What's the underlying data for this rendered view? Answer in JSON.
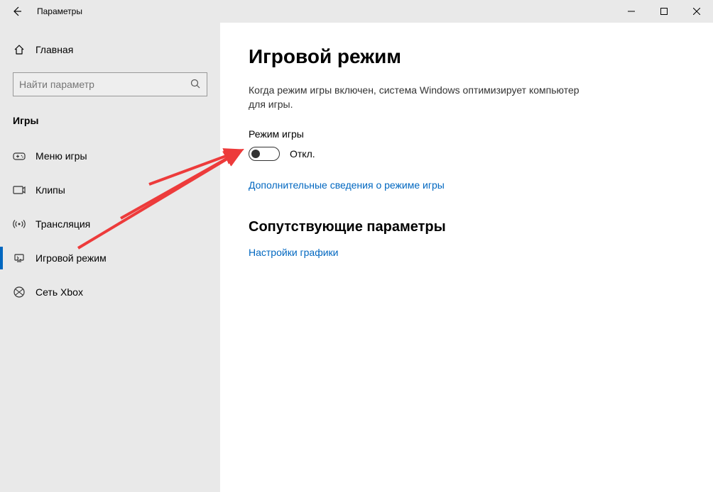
{
  "titlebar": {
    "title": "Параметры"
  },
  "sidebar": {
    "home": "Главная",
    "search_placeholder": "Найти параметр",
    "section": "Игры",
    "items": [
      {
        "label": "Меню игры"
      },
      {
        "label": "Клипы"
      },
      {
        "label": "Трансляция"
      },
      {
        "label": "Игровой режим"
      },
      {
        "label": "Сеть Xbox"
      }
    ]
  },
  "content": {
    "title": "Игровой режим",
    "description": "Когда режим игры включен, система Windows оптимизирует компьютер для игры.",
    "toggle_label": "Режим игры",
    "toggle_state": "Откл.",
    "more_link": "Дополнительные сведения о режиме игры",
    "related_heading": "Сопутствующие параметры",
    "related_link": "Настройки графики"
  }
}
